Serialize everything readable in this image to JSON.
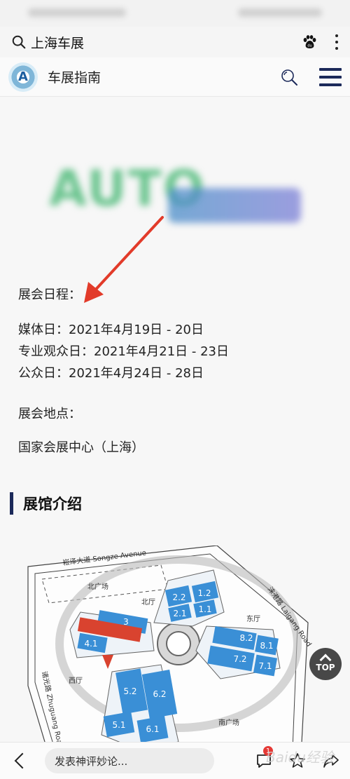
{
  "search": {
    "query": "上海车展"
  },
  "header": {
    "site_title": "车展指南",
    "logo_letter": "A"
  },
  "article": {
    "schedule_heading": "展会日程：",
    "schedule": [
      "媒体日：2021年4月19日 - 20日",
      "专业观众日：2021年4月21日 - 23日",
      "公众日：2021年4月24日 - 28日"
    ],
    "venue_heading": "展会地点：",
    "venue": "国家会展中心（上海）",
    "section_title": "展馆介绍"
  },
  "map": {
    "road_north": "崧泽大道 Songze Avenue",
    "road_east": "涞港路 Laigang Road",
    "road_west": "诸光路 Zhuguang Road",
    "north_plaza": "北广场",
    "south_plaza": "南广场",
    "north_hall": "北厅",
    "east_hall": "东厅",
    "west_hall": "西厅",
    "halls": {
      "h2_2": "2.2",
      "h1_2": "1.2",
      "h2_1": "2.1",
      "h1_1": "1.1",
      "h3": "3",
      "h4_1": "4.1",
      "h8_2": "8.2",
      "h8_1": "8.1",
      "h7_2": "7.2",
      "h7_1": "7.1",
      "h5_2": "5.2",
      "h6_2": "6.2",
      "h5_1": "5.1",
      "h6_1": "6.1"
    }
  },
  "top_button": {
    "label": "TOP"
  },
  "bottom": {
    "comment_placeholder": "发表神评妙论...",
    "badge_count": "1",
    "watermark": "Baidu经验"
  },
  "colors": {
    "hall_blue": "#3a8fd6",
    "hall_red": "#d9432f",
    "accent_navy": "#1c2a5a",
    "arrow_red": "#e23b2a"
  }
}
